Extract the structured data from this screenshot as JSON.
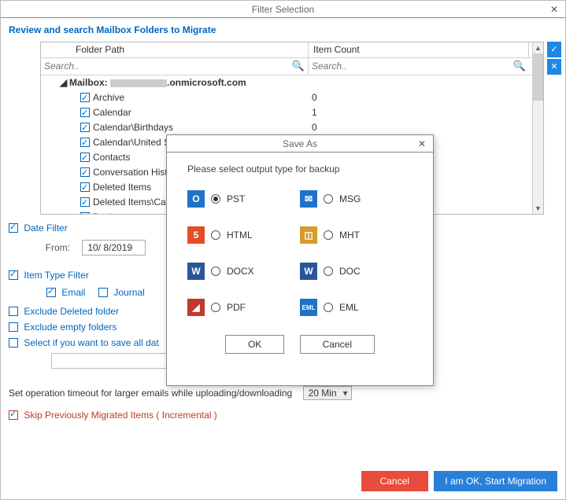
{
  "window": {
    "title": "Filter Selection",
    "close_glyph": "✕",
    "header": "Review and search Mailbox Folders to Migrate"
  },
  "grid": {
    "headers": {
      "path": "Folder Path",
      "count": "Item Count"
    },
    "search_placeholder": "Search..",
    "mailbox_label": "Mailbox:",
    "mailbox_domain": ".onmicrosoft.com",
    "rows": [
      {
        "name": "Archive",
        "count": "0"
      },
      {
        "name": "Calendar",
        "count": "1"
      },
      {
        "name": "Calendar\\Birthdays",
        "count": "0"
      },
      {
        "name": "Calendar\\United S",
        "count": ""
      },
      {
        "name": "Contacts",
        "count": ""
      },
      {
        "name": "Conversation Hist",
        "count": ""
      },
      {
        "name": "Deleted Items",
        "count": ""
      },
      {
        "name": "Deleted Items\\Ca",
        "count": ""
      },
      {
        "name": "Drafts",
        "count": ""
      }
    ]
  },
  "sidebuttons": {
    "check_all": "✓",
    "uncheck_all": "✕"
  },
  "filters": {
    "date_filter_label": "Date Filter",
    "from_label": "From:",
    "from_value": "10/ 8/2019",
    "item_type_label": "Item Type Filter",
    "types": {
      "email": "Email",
      "journal": "Journal"
    },
    "exclude_deleted": "Exclude Deleted folder",
    "exclude_empty": "Exclude empty folders",
    "save_all": "Select if you want to save all dat"
  },
  "timeout": {
    "label": "Set operation timeout for larger emails while uploading/downloading",
    "value": "20 Min"
  },
  "skip": {
    "label": "Skip Previously Migrated Items ( Incremental )"
  },
  "footer": {
    "cancel": "Cancel",
    "start": "I am OK, Start Migration"
  },
  "modal": {
    "title": "Save As",
    "close_glyph": "✕",
    "prompt": "Please select output type for backup",
    "options": [
      {
        "key": "pst",
        "label": "PST",
        "selected": true,
        "icon_color": "#1e73c8",
        "icon_text": "O"
      },
      {
        "key": "msg",
        "label": "MSG",
        "selected": false,
        "icon_color": "#1e73c8",
        "icon_text": "✉"
      },
      {
        "key": "html",
        "label": "HTML",
        "selected": false,
        "icon_color": "#e44d26",
        "icon_text": "5"
      },
      {
        "key": "mht",
        "label": "MHT",
        "selected": false,
        "icon_color": "#d79a2b",
        "icon_text": "◫"
      },
      {
        "key": "docx",
        "label": "DOCX",
        "selected": false,
        "icon_color": "#2a5699",
        "icon_text": "W"
      },
      {
        "key": "doc",
        "label": "DOC",
        "selected": false,
        "icon_color": "#2a5699",
        "icon_text": "W"
      },
      {
        "key": "pdf",
        "label": "PDF",
        "selected": false,
        "icon_color": "#c0392b",
        "icon_text": "◢"
      },
      {
        "key": "eml",
        "label": "EML",
        "selected": false,
        "icon_color": "#1e73c8",
        "icon_text": "EML"
      }
    ],
    "ok": "OK",
    "cancel": "Cancel"
  }
}
